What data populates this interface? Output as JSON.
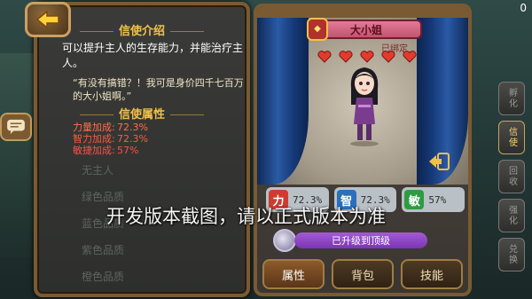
{
  "left_panel": {
    "intro_title": "信使介绍",
    "intro_text": "可以提升主人的生存能力，并能治疗主人。",
    "quote": "“有没有搞错？！我可是身价四千七百万的大小姐啊。”",
    "attr_title": "信使属性",
    "attributes": [
      {
        "label": "力量加成:",
        "value": "72.3%"
      },
      {
        "label": "智力加成:",
        "value": "72.3%"
      },
      {
        "label": "敏捷加成:",
        "value": "57%"
      }
    ],
    "faded_items": [
      "无主人",
      "绿色品质",
      "蓝色品质",
      "紫色品质",
      "橙色品质"
    ]
  },
  "card": {
    "name": "大小姐",
    "rank_badge": "◆",
    "bound_label": "已绑定",
    "hearts": 5,
    "stats": [
      {
        "icon_char": "力",
        "value": "72.3%"
      },
      {
        "icon_char": "智",
        "value": "72.3%"
      },
      {
        "icon_char": "敏",
        "value": "57%"
      }
    ],
    "level_text": "已升级到顶级",
    "tabs": [
      "属性",
      "背包",
      "技能"
    ],
    "active_tab": "属性"
  },
  "side_menu": {
    "top_counter": "0",
    "items": [
      "孵化",
      "信使",
      "回收",
      "强化",
      "兑换"
    ],
    "active_item": "信使"
  },
  "watermark": "开发版本截图，请以正式版本为准",
  "colors": {
    "panel_border": "#7a5a33",
    "title_gold": "#f2c04a",
    "heart_red": "#e23b2e",
    "power_red": "#cf3b30",
    "intel_blue": "#2b6fbd",
    "agile_green": "#2e9b43",
    "level_purple": "#8f45c6"
  },
  "icons": [
    "back-arrow-icon",
    "chat-bubble-icon",
    "heart-icon",
    "swap-arrow-icon",
    "level-ring-icon"
  ]
}
